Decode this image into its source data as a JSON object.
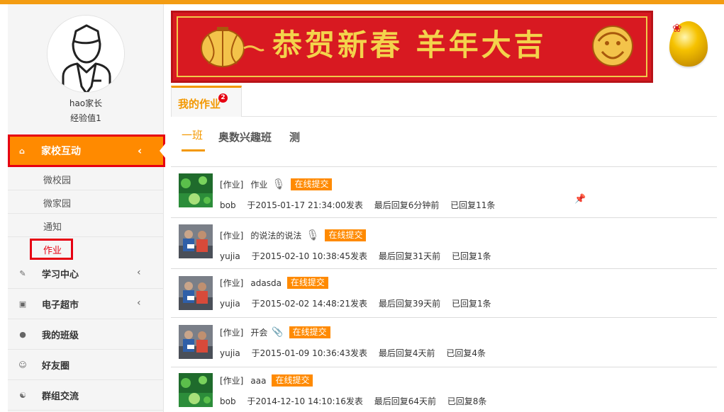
{
  "profile": {
    "name": "hao家长",
    "experience": "经验值1",
    "avatar_icon": "user-avatar-icon"
  },
  "sidebar": {
    "active_item": {
      "label": "家校互动",
      "icon": "home-icon"
    },
    "sub_items": [
      {
        "label": "微校园"
      },
      {
        "label": "微家园"
      },
      {
        "label": "通知"
      },
      {
        "label": "作业"
      }
    ],
    "items": [
      {
        "label": "学习中心",
        "icon": "edit-icon",
        "has_chevron": true
      },
      {
        "label": "电子超市",
        "icon": "cart-icon",
        "has_chevron": true
      },
      {
        "label": "我的班级",
        "icon": "user-icon",
        "has_chevron": false
      },
      {
        "label": "好友圈",
        "icon": "smile-icon",
        "has_chevron": false
      },
      {
        "label": "群组交流",
        "icon": "group-icon",
        "has_chevron": false
      }
    ]
  },
  "banner": {
    "text": "恭贺新春 羊年大吉"
  },
  "tabs": {
    "main_label": "我的作业",
    "badge_count": "2"
  },
  "class_tabs": [
    "一班",
    "奥数兴趣班",
    "测"
  ],
  "homework_list": [
    {
      "tag": "[作业]",
      "title": "作业",
      "attachment_icon": "microphone-icon",
      "status": "在线提交",
      "author": "bob",
      "posted": "于2015-01-17 21:34:00发表",
      "last_reply": "最后回复6分钟前",
      "replies": "已回复11条",
      "pinned": true
    },
    {
      "tag": "[作业]",
      "title": "的说法的说法",
      "attachment_icon": "microphone-icon",
      "status": "在线提交",
      "author": "yujia",
      "posted": "于2015-02-10 10:38:45发表",
      "last_reply": "最后回复31天前",
      "replies": "已回复1条",
      "pinned": false
    },
    {
      "tag": "[作业]",
      "title": "adasda",
      "attachment_icon": "",
      "status": "在线提交",
      "author": "yujia",
      "posted": "于2015-02-02 14:48:21发表",
      "last_reply": "最后回复39天前",
      "replies": "已回复1条",
      "pinned": false
    },
    {
      "tag": "[作业]",
      "title": "开会",
      "attachment_icon": "paperclip-icon",
      "status": "在线提交",
      "author": "yujia",
      "posted": "于2015-01-09 10:36:43发表",
      "last_reply": "最后回复4天前",
      "replies": "已回复4条",
      "pinned": false
    },
    {
      "tag": "[作业]",
      "title": "aaa",
      "attachment_icon": "",
      "status": "在线提交",
      "author": "bob",
      "posted": "于2014-12-10 14:10:16发表",
      "last_reply": "最后回复64天前",
      "replies": "已回复8条",
      "pinned": false
    }
  ],
  "colors": {
    "accent": "#ff8a00",
    "highlight_border": "#e60012",
    "tab_orange": "#f39800",
    "banner_red": "#d81921",
    "banner_gold": "#f3d34c"
  }
}
